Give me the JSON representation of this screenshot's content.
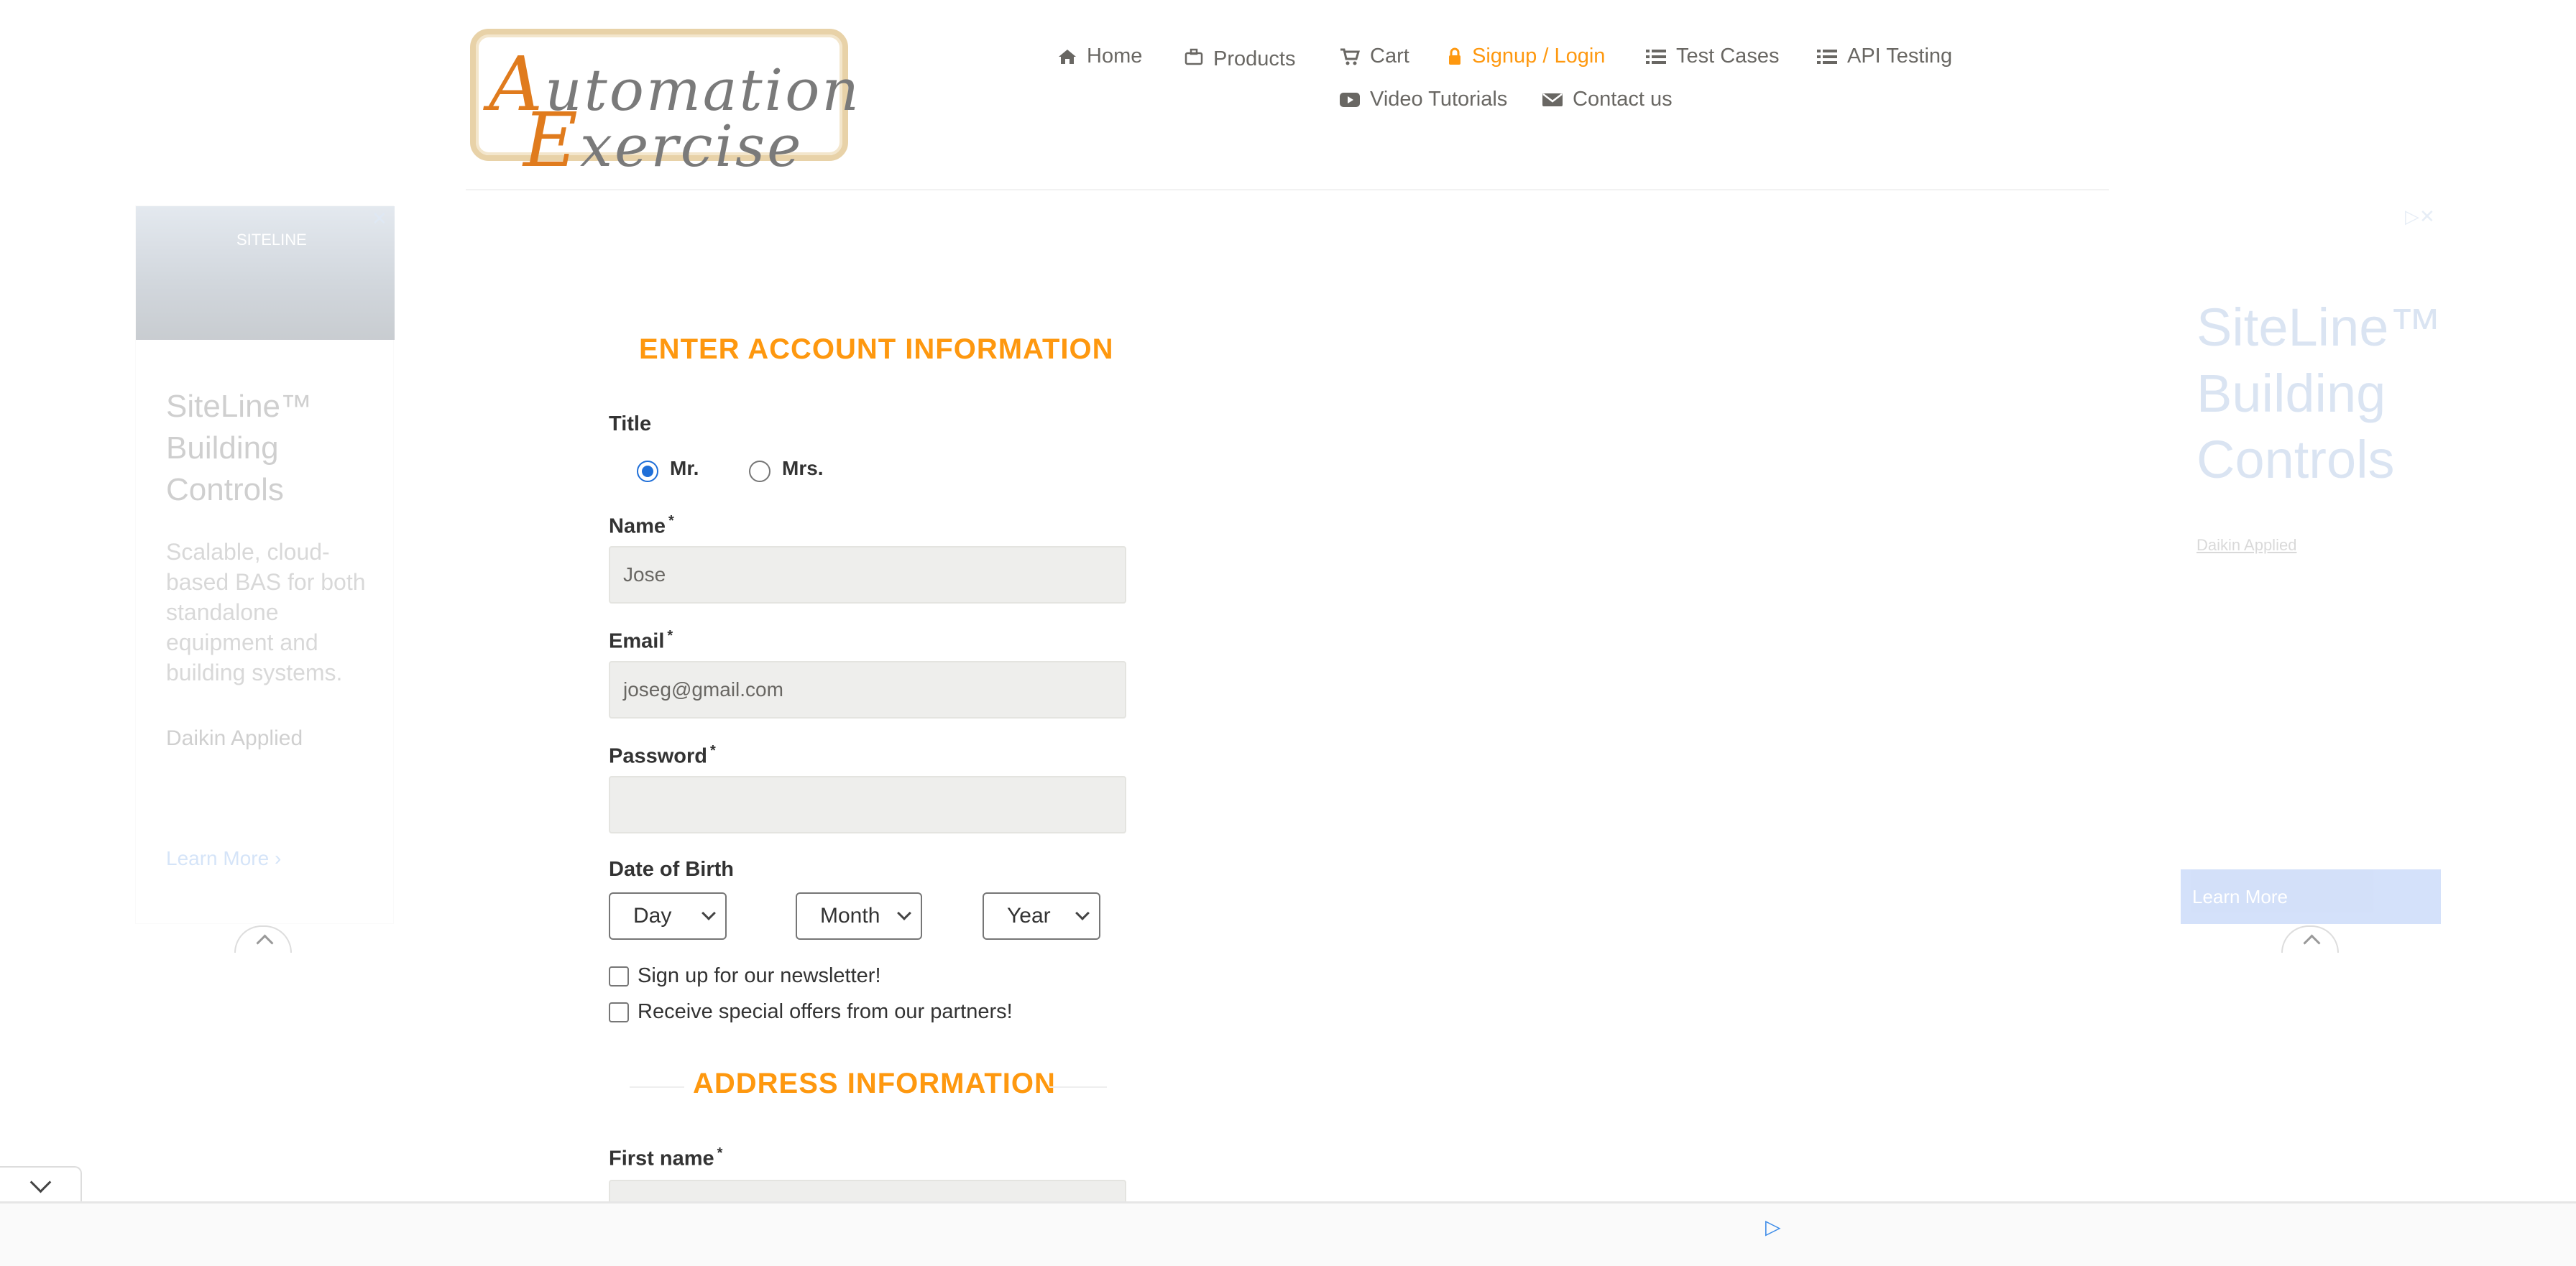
{
  "logo": {
    "line1_cap": "A",
    "line1_rest": "utomation",
    "line2_cap": "E",
    "line2_rest": "xercise"
  },
  "nav": {
    "home": "Home",
    "products": "Products",
    "cart": "Cart",
    "signup": "Signup / Login",
    "test_cases": "Test Cases",
    "api_testing": "API Testing",
    "video_tutorials": "Video Tutorials",
    "contact_us": "Contact us"
  },
  "colors": {
    "accent": "#fe980f",
    "input_bg": "#eeeeec",
    "text": "#333333",
    "nav_text": "#696763"
  },
  "ad_left": {
    "image_label": "SITELINE",
    "title": "SiteLine™ Building Controls",
    "description": "Scalable, cloud-based BAS for both standalone equipment and building systems.",
    "advertiser": "Daikin Applied",
    "cta": "Learn More"
  },
  "ad_right": {
    "title": "SiteLine™ Building Controls",
    "advertiser": "Daikin Applied",
    "cta": "Learn More"
  },
  "form": {
    "section_title": "ENTER ACCOUNT INFORMATION",
    "title_label": "Title",
    "title_options": [
      "Mr.",
      "Mrs."
    ],
    "title_selected": "Mr.",
    "name_label": "Name",
    "name_value": "Jose",
    "email_label": "Email",
    "email_value": "joseg@gmail.com",
    "password_label": "Password",
    "password_value": "",
    "dob_label": "Date of Birth",
    "dob_day": "Day",
    "dob_month": "Month",
    "dob_year": "Year",
    "newsletter_label": "Sign up for our newsletter!",
    "offers_label": "Receive special offers from our partners!",
    "required_mark": "*"
  },
  "address": {
    "section_title": "ADDRESS INFORMATION",
    "first_name_label": "First name"
  }
}
